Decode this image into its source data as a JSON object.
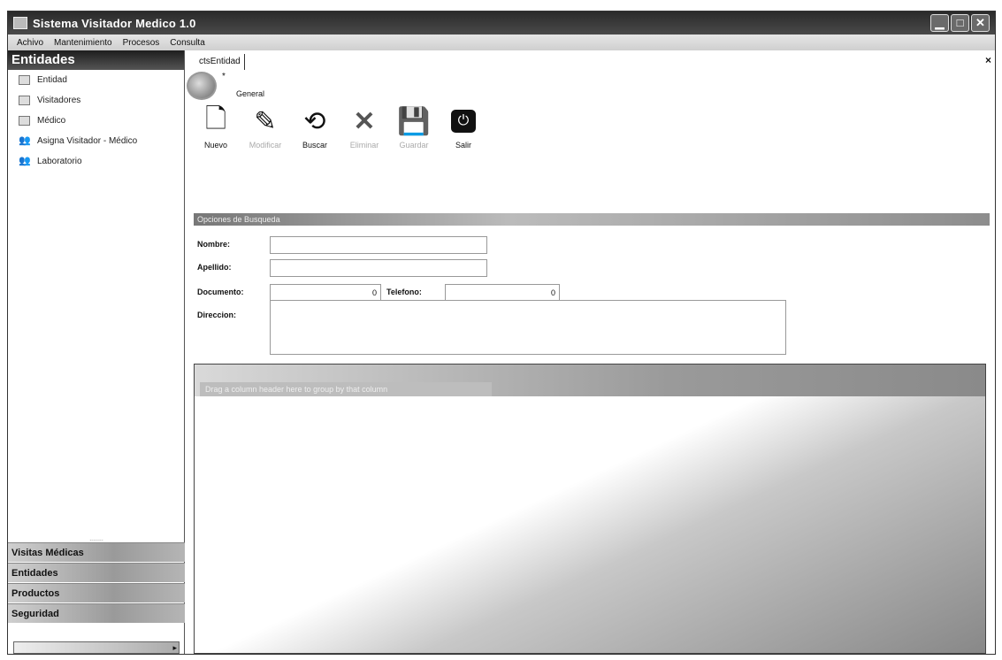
{
  "window": {
    "title": "Sistema Visitador Medico 1.0",
    "buttons": [
      "minimize",
      "maximize",
      "close"
    ]
  },
  "menu": [
    "Achivo",
    "Mantenimiento",
    "Procesos",
    "Consulta"
  ],
  "sidebar": {
    "header": "Entidades",
    "items": [
      {
        "label": "Entidad",
        "icon": "list-icon"
      },
      {
        "label": "Visitadores",
        "icon": "list-icon"
      },
      {
        "label": "Médico",
        "icon": "list-icon"
      },
      {
        "label": "Asigna Visitador - Médico",
        "icon": "people-icon"
      },
      {
        "label": "Laboratorio",
        "icon": "people-icon"
      }
    ],
    "sections": [
      "Visitas Médicas",
      "Entidades",
      "Productos",
      "Seguridad"
    ]
  },
  "main": {
    "tab": "ctsEntidad",
    "star": "*",
    "group_label": "General",
    "toolbar": [
      {
        "label": "Nuevo",
        "enabled": true
      },
      {
        "label": "Modificar",
        "enabled": false
      },
      {
        "label": "Buscar",
        "enabled": true
      },
      {
        "label": "Eliminar",
        "enabled": false
      },
      {
        "label": "Guardar",
        "enabled": false
      },
      {
        "label": "Salir",
        "enabled": true
      }
    ],
    "search": {
      "header": "Opciones de Busqueda",
      "nombre_label": "Nombre:",
      "nombre_value": "",
      "apellido_label": "Apellido:",
      "apellido_value": "",
      "documento_label": "Documento:",
      "documento_value": "0",
      "telefono_label": "Telefono:",
      "telefono_value": "0",
      "direccion_label": "Direccion:",
      "direccion_value": ""
    },
    "grid": {
      "group_hint": "Drag a column header here to group by that column"
    }
  }
}
